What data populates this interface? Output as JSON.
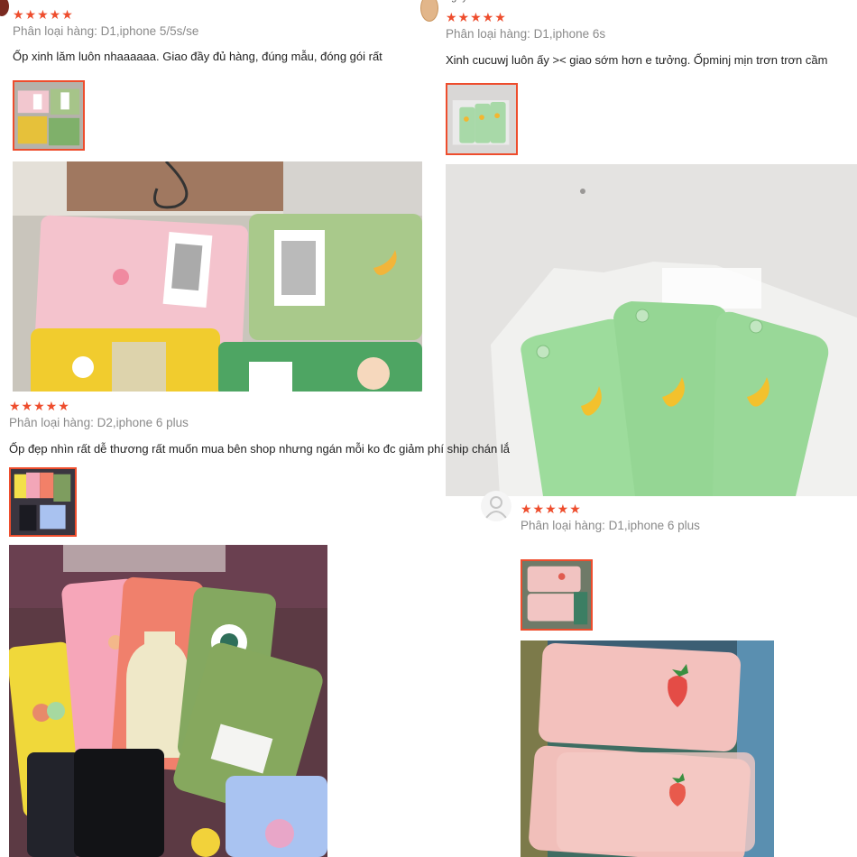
{
  "reviews": [
    {
      "rating": "★★★★★",
      "variant": "Phân loại hàng: D1,iphone 5/5s/se",
      "comment": "Ốp xinh lăm luôn nhaaaaaa. Giao đầy đủ hàng, đúng mẫu, đóng gói rất"
    },
    {
      "username": "nguyenhnh",
      "rating": "★★★★★",
      "variant": "Phân loại hàng: D1,iphone 6s",
      "comment": "Xinh cucuwj luôn ấy >< giao sớm hơn e tưởng. Ốpminj mịn trơn trơn cầm"
    },
    {
      "rating": "★★★★★",
      "variant": "Phân loại hàng: D2,iphone 6 plus",
      "comment": "Ốp đẹp nhìn rất dễ thương rất muốn mua bên shop nhưng ngán mỗi ko đc giảm phí ship chán lắ"
    },
    {
      "rating": "★★★★★",
      "variant": "Phân loại hàng: D1,iphone 6 plus"
    }
  ],
  "colors": {
    "star": "#ee4d2d",
    "thumb_border": "#ee4d2d",
    "variant_text": "#8a8a8a"
  },
  "icons": [
    "default-avatar-icon",
    "user-avatar-icon"
  ]
}
